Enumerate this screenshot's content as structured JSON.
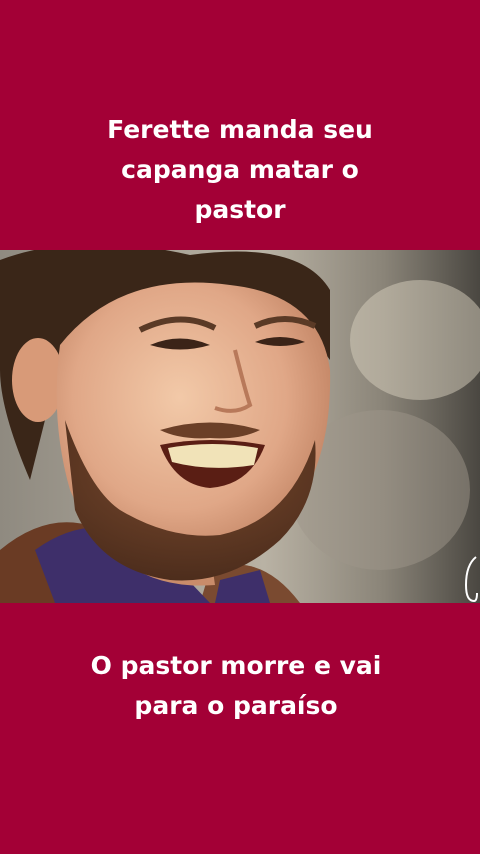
{
  "top_caption": {
    "line1": "Ferette manda seu",
    "line2": "capanga matar o",
    "line3": "pastor"
  },
  "bottom_caption": {
    "line1": "O pastor morre e vai",
    "line2": "para o paraíso"
  },
  "frame": {
    "subject": "smiling bearded man",
    "background_color": "#a30036"
  }
}
